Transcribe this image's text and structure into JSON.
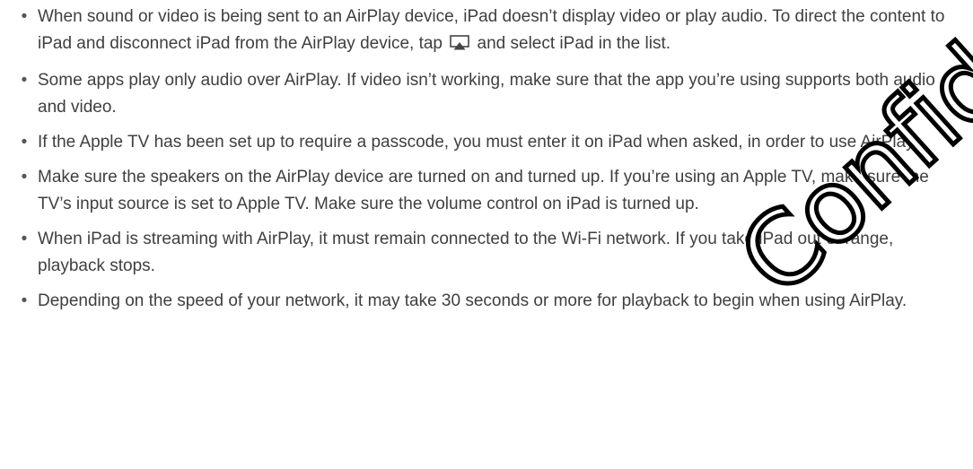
{
  "bullets": [
    {
      "before_icon": "When sound or video is being sent to an AirPlay device, iPad doesn’t display video or play audio. To direct the content to iPad and disconnect iPad from the AirPlay device, tap ",
      "icon": "airplay-icon",
      "after_icon": " and select iPad in the list."
    },
    {
      "text": "Some apps play only audio over AirPlay. If video isn’t working, make sure that the app you’re using supports both audio and video."
    },
    {
      "text": "If the Apple TV has been set up to require a passcode, you must enter it on iPad when asked, in order to use AirPlay."
    },
    {
      "text": "Make sure the speakers on the AirPlay device are turned on and turned up. If you’re using an Apple TV, make sure the TV’s input source is set to Apple TV. Make sure the volume control on iPad is turned up."
    },
    {
      "text": "When iPad is streaming with AirPlay, it must remain connected to the Wi-Fi network. If you take iPad out of range, playback stops."
    },
    {
      "text": "Depending on the speed of your network, it may take 30 seconds or more for playback to begin when using AirPlay."
    }
  ],
  "bullet_symbol": "•",
  "watermark": "Confidential"
}
